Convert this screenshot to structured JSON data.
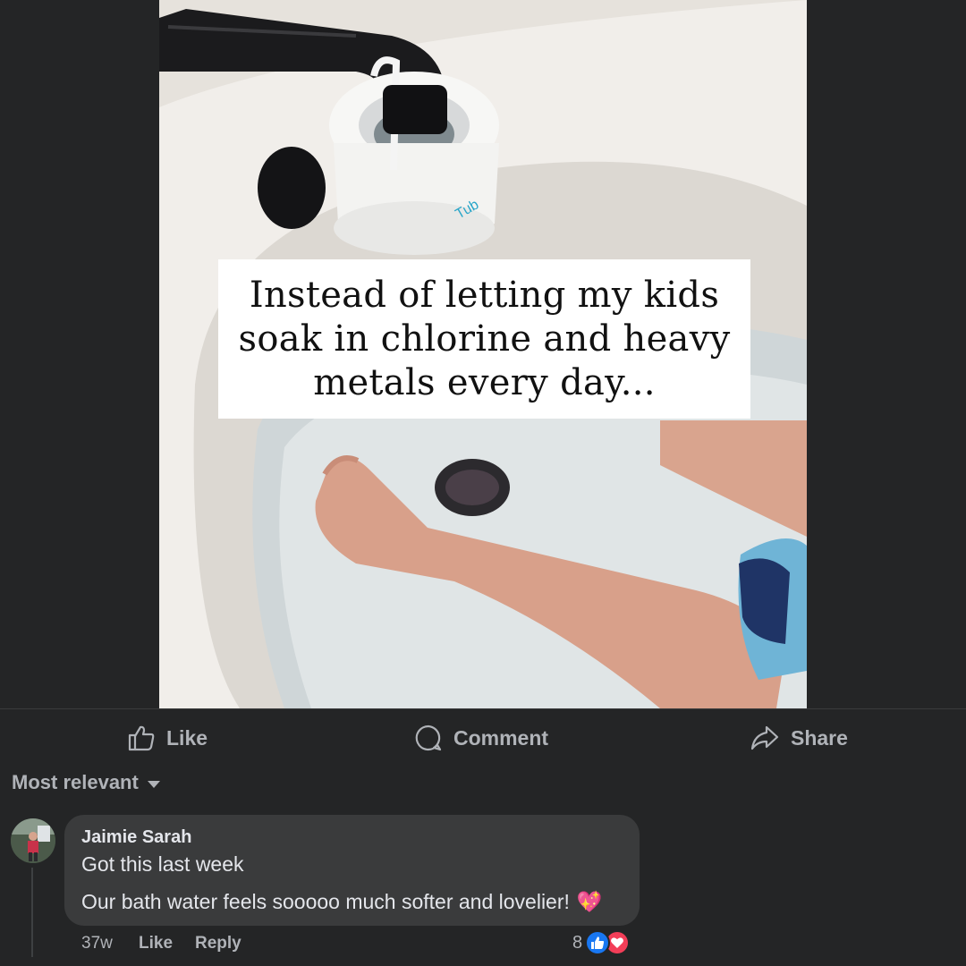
{
  "post": {
    "media": {
      "caption": "Instead of letting my kids soak in chlorine and heavy metals every day..."
    }
  },
  "actions": {
    "like_label": "Like",
    "comment_label": "Comment",
    "share_label": "Share"
  },
  "comments_sort": {
    "label": "Most relevant"
  },
  "comment": {
    "author": "Jaimie Sarah",
    "lines": [
      "Got this last week",
      "Our bath water feels sooooo much softer and lovelier!"
    ],
    "emoji": "💖",
    "time": "37w",
    "like_label": "Like",
    "reply_label": "Reply",
    "reaction_count": "8",
    "reactions": [
      "like-icon",
      "love-icon"
    ]
  },
  "colors": {
    "background": "#242526",
    "bubble": "#3a3b3c",
    "secondary_text": "#b0b3b8",
    "primary_text": "#e4e6eb",
    "like_blue": "#1877f2",
    "love_red": "#f33e58"
  }
}
